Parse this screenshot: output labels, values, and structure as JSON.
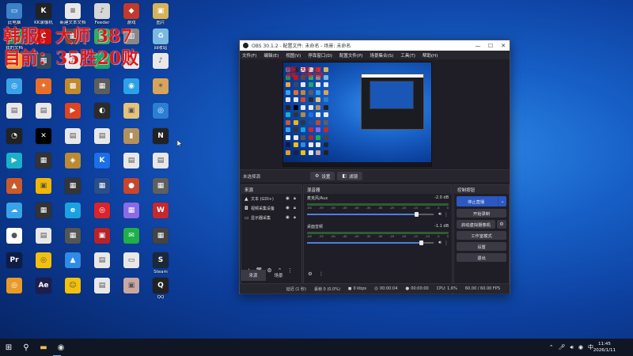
{
  "overlay": {
    "line1": "韩服：大师 387",
    "line2": "目前：35胜20败"
  },
  "desktop_icons": [
    {
      "label": "此电脑",
      "color": "#3b82c9",
      "glyph": "▭",
      "icon": "computer-icon"
    },
    {
      "label": "KK录像机",
      "color": "#222",
      "glyph": "K",
      "icon": "app-icon"
    },
    {
      "label": "新建文本文档",
      "color": "#e8e8e8",
      "glyph": "≡",
      "icon": "document-icon"
    },
    {
      "label": "Feeder",
      "color": "#d7d7d7",
      "glyph": "♪",
      "icon": "audio-file-icon"
    },
    {
      "label": "游戏",
      "color": "#c23a2b",
      "glyph": "◆",
      "icon": "game-icon"
    },
    {
      "label": "图片",
      "color": "#d6b35a",
      "glyph": "▣",
      "icon": "image-icon"
    },
    {
      "label": "我的文档",
      "color": "#2e8b57",
      "glyph": "◆",
      "icon": "app-icon"
    },
    {
      "label": "",
      "color": "#c11",
      "glyph": "C",
      "icon": "app-icon"
    },
    {
      "label": "",
      "color": "#4d4d4d",
      "glyph": "▦",
      "icon": "app-icon"
    },
    {
      "label": "",
      "color": "#3a6",
      "glyph": "▤",
      "icon": "app-icon"
    },
    {
      "label": "",
      "color": "#888",
      "glyph": "▥",
      "icon": "app-icon"
    },
    {
      "label": "回收站",
      "color": "#7ab8e0",
      "glyph": "♻",
      "icon": "recycle-bin-icon"
    },
    {
      "label": "",
      "color": "#f3a23a",
      "glyph": "★",
      "icon": "app-icon"
    },
    {
      "label": "",
      "color": "#364a5c",
      "glyph": "▦",
      "icon": "app-icon"
    },
    {
      "label": "",
      "color": "#e8e8e8",
      "glyph": "♪",
      "icon": "audio-file-icon"
    },
    {
      "label": "",
      "color": "#1aa865",
      "glyph": "▲",
      "icon": "app-icon"
    },
    {
      "label": "",
      "color": "#e8e8e8",
      "glyph": "▤",
      "icon": "app-icon"
    },
    {
      "label": "",
      "color": "#e8e8e8",
      "glyph": "♪",
      "icon": "audio-file-icon"
    },
    {
      "label": "",
      "color": "#3aa2e8",
      "glyph": "◎",
      "icon": "app-icon"
    },
    {
      "label": "",
      "color": "#e86f2a",
      "glyph": "✦",
      "icon": "app-icon"
    },
    {
      "label": "",
      "color": "#c08a2d",
      "glyph": "▩",
      "icon": "app-icon"
    },
    {
      "label": "",
      "color": "#5d5d5d",
      "glyph": "▦",
      "icon": "app-icon"
    },
    {
      "label": "",
      "color": "#2aa1e8",
      "glyph": "◉",
      "icon": "app-icon"
    },
    {
      "label": "",
      "color": "#d8a45a",
      "glyph": "✶",
      "icon": "app-icon"
    },
    {
      "label": "",
      "color": "#e8e8e8",
      "glyph": "▤",
      "icon": "app-icon"
    },
    {
      "label": "",
      "color": "#e8e8e8",
      "glyph": "▤",
      "icon": "app-icon"
    },
    {
      "label": "",
      "color": "#d42",
      "glyph": "▶",
      "icon": "app-icon"
    },
    {
      "label": "",
      "color": "#2b2b2b",
      "glyph": "◐",
      "icon": "app-icon"
    },
    {
      "label": "",
      "color": "#e4c37a",
      "glyph": "▣",
      "icon": "app-icon"
    },
    {
      "label": "",
      "color": "#2a7fd4",
      "glyph": "◎",
      "icon": "app-icon"
    },
    {
      "label": "",
      "color": "#222",
      "glyph": "◔",
      "icon": "app-icon"
    },
    {
      "label": "",
      "color": "#000",
      "glyph": "✕",
      "icon": "app-icon"
    },
    {
      "label": "",
      "color": "#e8e8e8",
      "glyph": "▤",
      "icon": "app-icon"
    },
    {
      "label": "",
      "color": "#e8e8e8",
      "glyph": "▤",
      "icon": "app-icon"
    },
    {
      "label": "",
      "color": "#b3915c",
      "glyph": "▮",
      "icon": "app-icon"
    },
    {
      "label": "",
      "color": "#222",
      "glyph": "N",
      "icon": "app-icon"
    },
    {
      "label": "",
      "color": "#1bb0c9",
      "glyph": "▶",
      "icon": "app-icon"
    },
    {
      "label": "",
      "color": "#333",
      "glyph": "▦",
      "icon": "app-icon"
    },
    {
      "label": "",
      "color": "#ba8a35",
      "glyph": "◈",
      "icon": "app-icon"
    },
    {
      "label": "",
      "color": "#1c6fe8",
      "glyph": "K",
      "icon": "app-icon"
    },
    {
      "label": "",
      "color": "#e8e8e8",
      "glyph": "▤",
      "icon": "app-icon"
    },
    {
      "label": "",
      "color": "#e8e8e8",
      "glyph": "▤",
      "icon": "app-icon"
    },
    {
      "label": "",
      "color": "#c95a2a",
      "glyph": "▲",
      "icon": "app-icon"
    },
    {
      "label": "",
      "color": "#f2b705",
      "glyph": "▣",
      "icon": "app-icon"
    },
    {
      "label": "",
      "color": "#353535",
      "glyph": "▦",
      "icon": "app-icon"
    },
    {
      "label": "",
      "color": "#2a4f8a",
      "glyph": "▦",
      "icon": "app-icon"
    },
    {
      "label": "",
      "color": "#c8462c",
      "glyph": "●",
      "icon": "app-icon"
    },
    {
      "label": "",
      "color": "#5f5f5f",
      "glyph": "▦",
      "icon": "app-icon"
    },
    {
      "label": "",
      "color": "#38a3e8",
      "glyph": "☁",
      "icon": "app-icon"
    },
    {
      "label": "",
      "color": "#333",
      "glyph": "▦",
      "icon": "app-icon"
    },
    {
      "label": "",
      "color": "#1ba1e2",
      "glyph": "e",
      "icon": "browser-icon"
    },
    {
      "label": "",
      "color": "#d8242a",
      "glyph": "◎",
      "icon": "app-icon"
    },
    {
      "label": "",
      "color": "#8a6ae8",
      "glyph": "▦",
      "icon": "app-icon"
    },
    {
      "label": "",
      "color": "#c7282d",
      "glyph": "W",
      "icon": "app-icon"
    },
    {
      "label": "",
      "color": "#fff",
      "glyph": "●",
      "icon": "app-icon"
    },
    {
      "label": "",
      "color": "#e8e8e8",
      "glyph": "▤",
      "icon": "app-icon"
    },
    {
      "label": "",
      "color": "#555",
      "glyph": "▦",
      "icon": "app-icon"
    },
    {
      "label": "",
      "color": "#b8222a",
      "glyph": "▣",
      "icon": "app-icon"
    },
    {
      "label": "",
      "color": "#1fb04a",
      "glyph": "✉",
      "icon": "app-icon"
    },
    {
      "label": "",
      "color": "#444",
      "glyph": "▦",
      "icon": "app-icon"
    },
    {
      "label": "",
      "color": "#0f1d44",
      "glyph": "Pr",
      "icon": "app-icon"
    },
    {
      "label": "",
      "color": "#f2c10e",
      "glyph": "◎",
      "icon": "app-icon"
    },
    {
      "label": "",
      "color": "#2e8be8",
      "glyph": "▲",
      "icon": "app-icon"
    },
    {
      "label": "",
      "color": "#e8e8e8",
      "glyph": "▤",
      "icon": "app-icon"
    },
    {
      "label": "",
      "color": "#e8e8e8",
      "glyph": "▭",
      "icon": "app-icon"
    },
    {
      "label": "Steam",
      "color": "#1b2838",
      "glyph": "S",
      "icon": "app-icon"
    },
    {
      "label": "",
      "color": "#e89a2a",
      "glyph": "◎",
      "icon": "app-icon"
    },
    {
      "label": "",
      "color": "#1e1e4a",
      "glyph": "Ae",
      "icon": "app-icon"
    },
    {
      "label": "",
      "color": "#f2c10e",
      "glyph": "☺",
      "icon": "app-icon"
    },
    {
      "label": "",
      "color": "#e8e8e8",
      "glyph": "▤",
      "icon": "app-icon"
    },
    {
      "label": "",
      "color": "#c9a7a2",
      "glyph": "▣",
      "icon": "app-icon"
    },
    {
      "label": "QQ",
      "color": "#222",
      "glyph": "Q",
      "icon": "app-icon"
    }
  ],
  "obs": {
    "title": "OBS 30.1.2 - 配置文件: 未命名 - 场景: 未命名",
    "menu": [
      "文件(F)",
      "编辑(E)",
      "视图(V)",
      "停靠窗口(D)",
      "配置文件(P)",
      "场景集合(S)",
      "工具(T)",
      "帮助(H)"
    ],
    "context": {
      "no_source": "未选择源",
      "properties": "设置",
      "filters": "滤镜"
    },
    "sources": {
      "header": "来源",
      "items": [
        {
          "name": "文本 (GDI+)",
          "icon": "text-icon"
        },
        {
          "name": "视频采集设备",
          "icon": "camera-icon"
        },
        {
          "name": "显示器采集",
          "icon": "monitor-icon"
        }
      ]
    },
    "mixer": {
      "header": "混音器",
      "tracks": [
        {
          "name": "麦克风/Aux",
          "db": "-2.0 dB",
          "level": 0.86
        },
        {
          "name": "桌面音频",
          "db": "-1.1 dB",
          "level": 0.9
        }
      ],
      "ticks": [
        "-60",
        "-55",
        "-50",
        "-45",
        "-40",
        "-35",
        "-30",
        "-25",
        "-20",
        "-15",
        "-10",
        "-5",
        "0"
      ]
    },
    "controls": {
      "header": "控制按钮",
      "stop_stream": "停止直播",
      "start_record": "开始录制",
      "virtual_cam": "启动虚拟摄像机",
      "studio_mode": "工作室模式",
      "settings": "设置",
      "exit": "退出"
    },
    "tabs": {
      "sources": "来源",
      "scenes": "场景"
    },
    "status": {
      "delay": "延迟 (1 秒)",
      "dropped": "丢帧 0 (0.0%)",
      "bitrate": "0 kbps",
      "stream_time": "00:00:04",
      "record_time": "00:00:00",
      "cpu": "CPU: 1.6%",
      "fps": "60.00 / 60.00 FPS"
    }
  },
  "taskbar": {
    "time": "11:45",
    "date": "2026/1/11"
  }
}
